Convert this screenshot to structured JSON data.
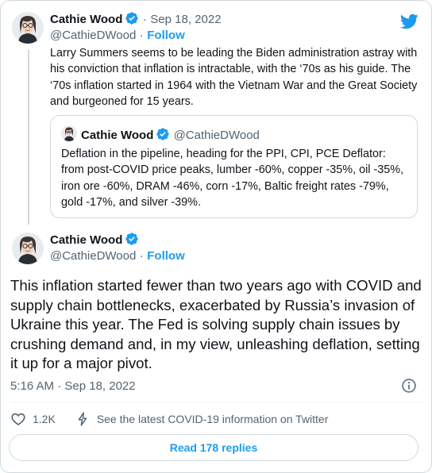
{
  "tweet1": {
    "author": "Cathie Wood",
    "date": "Sep 18, 2022",
    "separator": "·",
    "handle": "@CathieDWood",
    "follow_label": "Follow",
    "text": "Larry Summers seems to be leading the Biden administration astray with his conviction that inflation is intractable, with the ‘70s as his guide. The ‘70s inflation started in 1964 with the Vietnam War and the Great Society and burgeoned for 15 years."
  },
  "quote": {
    "author": "Cathie Wood",
    "handle": "@CathieDWood",
    "text": "Deflation in the pipeline, heading for the PPI, CPI, PCE Deflator: from post-COVID price peaks, lumber -60%, copper -35%, oil -35%, iron ore -60%, DRAM -46%, corn -17%, Baltic freight rates -79%, gold -17%, and silver -39%."
  },
  "tweet2": {
    "author": "Cathie Wood",
    "handle": "@CathieDWood",
    "separator": "·",
    "follow_label": "Follow",
    "text": "This inflation started fewer than two years ago with COVID and supply chain bottlenecks, exacerbated by Russia’s invasion of Ukraine this year. The Fed is solving supply chain issues by crushing demand and, in my view, unleashing deflation, setting it up for a major pivot.",
    "timestamp": "5:16 AM · Sep 18, 2022"
  },
  "actions": {
    "like_count": "1.2K",
    "covid_info": "See the latest COVID-19 information on Twitter",
    "read_replies": "Read 178 replies"
  },
  "colors": {
    "accent": "#1d9bf0",
    "text": "#0f1419",
    "muted": "#536471",
    "border": "#cfd9de"
  },
  "icons": [
    "twitter-bird-icon",
    "verified-badge-icon",
    "info-icon",
    "heart-icon",
    "lightning-icon"
  ]
}
